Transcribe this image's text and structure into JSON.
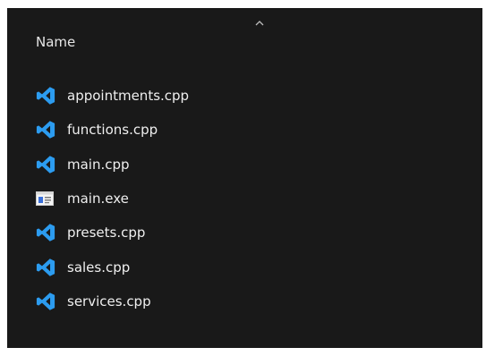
{
  "colors": {
    "background": "#191919",
    "text": "#efefef",
    "vscode_icon": "#2c9cf0",
    "exe_icon_frame": "#e8e8e8",
    "exe_icon_accent": "#3a6fd8"
  },
  "header": {
    "column_name": "Name",
    "sort_direction": "ascending",
    "sort_icon": "chevron-up-icon"
  },
  "files": [
    {
      "name": "appointments.cpp",
      "icon": "vscode-icon"
    },
    {
      "name": "functions.cpp",
      "icon": "vscode-icon"
    },
    {
      "name": "main.cpp",
      "icon": "vscode-icon"
    },
    {
      "name": "main.exe",
      "icon": "exe-icon"
    },
    {
      "name": "presets.cpp",
      "icon": "vscode-icon"
    },
    {
      "name": "sales.cpp",
      "icon": "vscode-icon"
    },
    {
      "name": "services.cpp",
      "icon": "vscode-icon"
    }
  ]
}
